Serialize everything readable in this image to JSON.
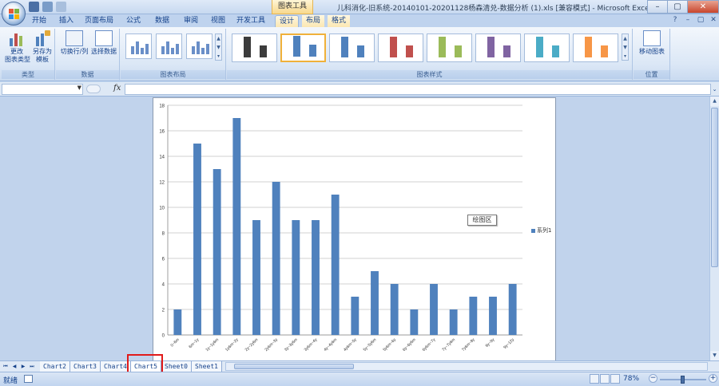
{
  "titlebar": {
    "tool_label": "图表工具",
    "title": "儿科消化-旧系统-20140101-20201128杨森清兑-数据分析 (1).xls [兼容模式] - Microsoft Excel",
    "minimize": "–",
    "maximize": "▢",
    "close": "✕"
  },
  "tabs": [
    "开始",
    "插入",
    "页面布局",
    "公式",
    "数据",
    "审阅",
    "视图",
    "开发工具",
    "设计",
    "布局",
    "格式"
  ],
  "active_tab": "设计",
  "help": [
    "?",
    "–",
    "▢",
    "✕"
  ],
  "ribbon": {
    "groups": {
      "type": {
        "label": "类型",
        "change_type": "更改\n图表类型",
        "save_template": "另存为\n模板"
      },
      "data": {
        "label": "数据",
        "switch_row_col": "切换行/列",
        "select_data": "选择数据"
      },
      "layout": {
        "label": "图表布局"
      },
      "styles": {
        "label": "图表样式"
      },
      "location": {
        "label": "位置",
        "move_chart": "移动图表"
      }
    },
    "style_colors": [
      "#3c3c3c",
      "#4f81bd",
      "#4f81bd",
      "#c0504d",
      "#9bbb59",
      "#8064a2",
      "#4bacc6",
      "#f79646"
    ],
    "style_bar_heights": [
      [
        26,
        15
      ],
      [
        26,
        15
      ],
      [
        26,
        15
      ],
      [
        26,
        15
      ],
      [
        26,
        15
      ],
      [
        26,
        15
      ],
      [
        26,
        15
      ],
      [
        26,
        15
      ]
    ],
    "selected_style": 1
  },
  "formula_bar": {
    "fx": "fx",
    "value": ""
  },
  "chart_data": {
    "type": "bar",
    "categories": [
      "0~6m",
      "6m~1y",
      "1y~1y6m",
      "1y6m~2y",
      "2y~2y6m",
      "2y6m~3y",
      "3y~3y6m",
      "3y6m~4y",
      "4y~4y6m",
      "4y6m~5y",
      "5y~5y6m",
      "5y6m~6y",
      "6y~6y6m",
      "6y6m~7y",
      "7y~7y6m",
      "7y6m~8y",
      "8y~9y",
      "9y~12y"
    ],
    "series": [
      {
        "name": "系列1",
        "values": [
          2,
          15,
          13,
          17,
          9,
          12,
          9,
          9,
          11,
          3,
          5,
          4,
          2,
          4,
          2,
          3,
          3,
          4
        ]
      }
    ],
    "ylim": [
      0,
      18
    ],
    "yticks": [
      0,
      2,
      4,
      6,
      8,
      10,
      12,
      14,
      16,
      18
    ],
    "grid": true,
    "legend": "right",
    "bar_color": "#4f81bd",
    "tooltip": "绘图区"
  },
  "sheets": [
    "Chart2",
    "Chart3",
    "Chart4",
    "Chart5",
    "Sheet0",
    "Sheet1"
  ],
  "active_sheet": "Chart5",
  "status": {
    "text": "就绪",
    "zoom": "78%",
    "zoom_level": 0.78
  }
}
